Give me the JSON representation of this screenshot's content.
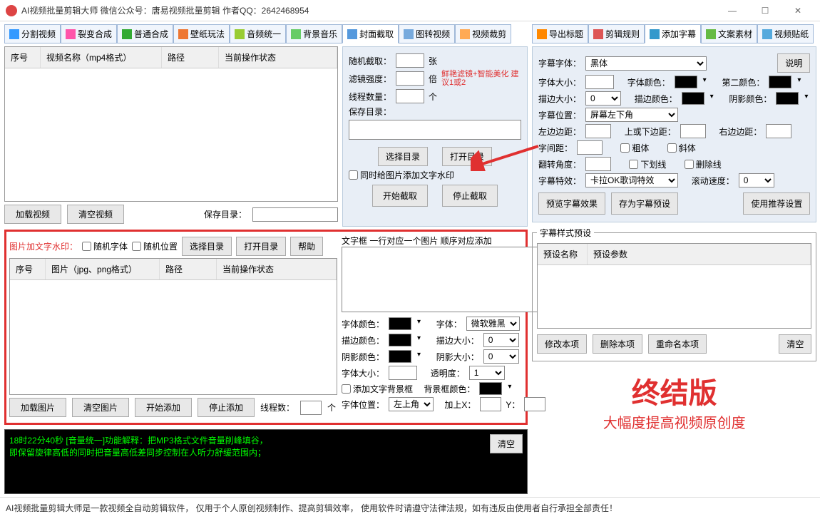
{
  "window": {
    "title": "AI视频批量剪辑大师   微信公众号：唐易视频批量剪辑      作者QQ：2642468954"
  },
  "main_tabs": [
    "分割视频",
    "裂变合成",
    "普通合成",
    "壁纸玩法",
    "音频统一",
    "背景音乐",
    "封面截取",
    "图转视频",
    "视频裁剪"
  ],
  "right_tabs": [
    "导出标题",
    "剪辑规则",
    "添加字幕",
    "文案素材",
    "视频贴纸"
  ],
  "grid1": {
    "cols": [
      "序号",
      "视频名称（mp4格式）",
      "路径",
      "当前操作状态"
    ]
  },
  "btns1": {
    "load": "加载视频",
    "clear": "清空视频",
    "savedir": "保存目录："
  },
  "watermark": {
    "title": "图片加文字水印：",
    "rand_font": "随机字体",
    "rand_pos": "随机位置",
    "select_dir": "选择目录",
    "open_dir": "打开目录",
    "help": "帮助"
  },
  "grid2": {
    "cols": [
      "序号",
      "图片（jpg、png格式）",
      "路径",
      "当前操作状态"
    ]
  },
  "btns2": {
    "load": "加载图片",
    "clear": "清空图片",
    "start": "开始添加",
    "stop": "停止添加",
    "threads": "线程数：",
    "unit": "个"
  },
  "cover": {
    "rand_cap": "随机截取：",
    "unit_zhang": "张",
    "filter": "滤镜强度：",
    "unit_bei": "倍",
    "filter_note": "鲜艳滤镜+智能美化 建议1或2",
    "threads": "线程数量：",
    "unit_ge": "个",
    "savedir": "保存目录：",
    "select_dir": "选择目录",
    "open_dir": "打开目录",
    "add_wm": "同时给图片添加文字水印",
    "start": "开始截取",
    "stop": "停止截取",
    "textbox_title": "文字框 一行对应一个图片 顺序对应添加",
    "font_color": "字体颜色：",
    "font": "字体：",
    "font_val": "微软雅黑",
    "stroke_color": "描边颜色：",
    "stroke_size": "描边大小：",
    "stroke_val": "0",
    "shadow_color": "阴影颜色：",
    "shadow_size": "阴影大小：",
    "shadow_val": "0",
    "font_size": "字体大小：",
    "opacity": "透明度：",
    "opacity_val": "1",
    "add_bg": "添加文字背景框",
    "bg_color": "背景框颜色：",
    "font_pos": "字体位置：",
    "pos_val": "左上角",
    "addx": "加上X：",
    "y": "Y："
  },
  "subtitle": {
    "explain": "说明",
    "font": "字幕字体：",
    "font_val": "黑体",
    "size": "字体大小：",
    "color": "字体颜色：",
    "color2": "第二颜色：",
    "stroke": "描边大小：",
    "stroke_val": "0",
    "stroke_color": "描边颜色：",
    "shadow_color": "阴影颜色：",
    "pos": "字幕位置：",
    "pos_val": "屏幕左下角",
    "left": "左边边距：",
    "top": "上或下边距：",
    "right": "右边边距：",
    "spacing": "字间距：",
    "bold": "粗体",
    "italic": "斜体",
    "rotate": "翻转角度：",
    "underline": "下划线",
    "strike": "删除线",
    "effect": "字幕特效：",
    "effect_val": "卡拉OK歌词特效",
    "speed": "滚动速度：",
    "speed_val": "0",
    "preview": "预览字幕效果",
    "save_preset": "存为字幕预设",
    "use_rec": "使用推荐设置",
    "preset_group": "字幕样式预设",
    "preset_cols": [
      "预设名称",
      "预设参数"
    ],
    "edit": "修改本项",
    "del": "删除本项",
    "rename": "重命名本项",
    "clear": "清空"
  },
  "log": {
    "line1": "18时22分40秒 [音量统一]功能解释：把MP3格式文件音量削峰填谷，",
    "line2": "       即保留旋律高低的同时把音量高低差同步控制在人听力舒缓范围内；",
    "clear": "清空"
  },
  "promo": {
    "t1": "终结版",
    "t2": "大幅度提高视频原创度"
  },
  "footer": "AI视频批量剪辑大师是一款视频全自动剪辑软件，   仅用于个人原创视频制作、提高剪辑效率，   使用软件时请遵守法律法规，如有违反由使用者自行承担全部责任！"
}
